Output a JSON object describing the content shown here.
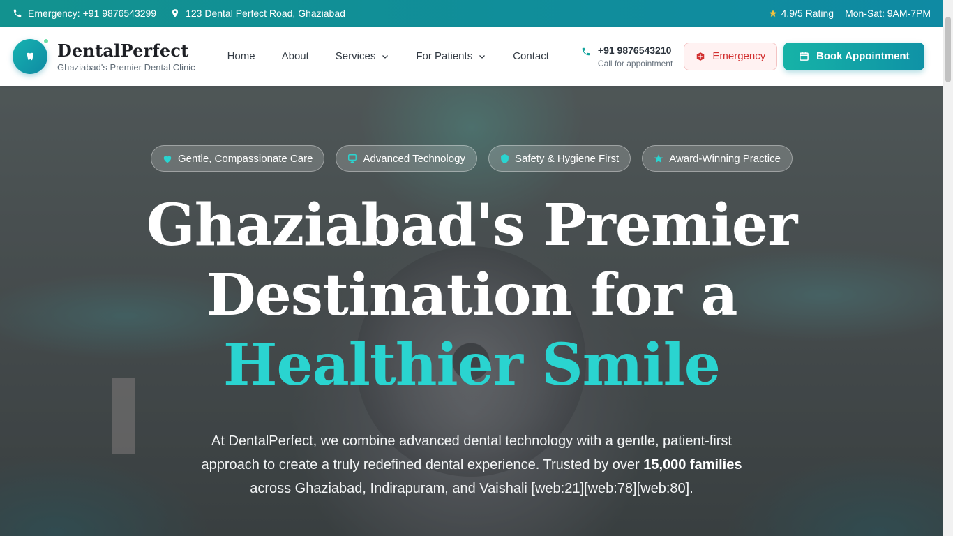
{
  "topbar": {
    "emergency": "Emergency: +91 9876543299",
    "address": "123 Dental Perfect Road, Ghaziabad",
    "rating": "4.9/5 Rating",
    "hours": "Mon-Sat: 9AM-7PM"
  },
  "header": {
    "brand_name": "DentalPerfect",
    "brand_tagline": "Ghaziabad's Premier Dental Clinic",
    "nav": [
      {
        "label": "Home",
        "icon": ""
      },
      {
        "label": "About",
        "icon": ""
      },
      {
        "label": "Services",
        "icon": "chevron-down-icon"
      },
      {
        "label": "For Patients",
        "icon": "chevron-down-icon"
      },
      {
        "label": "Contact",
        "icon": ""
      }
    ],
    "phone": "+91 9876543210",
    "phone_sub": "Call for appointment",
    "emergency_button": "Emergency",
    "book_button": "Book Appointment"
  },
  "hero": {
    "badges": [
      {
        "label": "Gentle, Compassionate Care",
        "icon": "heart-icon"
      },
      {
        "label": "Advanced Technology",
        "icon": "monitor-icon"
      },
      {
        "label": "Safety & Hygiene First",
        "icon": "shield-icon"
      },
      {
        "label": "Award-Winning Practice",
        "icon": "star-icon"
      }
    ],
    "headline_line1": "Ghaziabad's Premier",
    "headline_line2": "Destination for a",
    "headline_accent": "Healthier Smile",
    "desc_line1": "At DentalPerfect, we combine advanced dental technology with a gentle, patient-first",
    "desc_line2_pre": "approach to create a truly redefined dental experience. Trusted by over ",
    "desc_line2_bold": "15,000 families",
    "desc_line3": "across Ghaziabad, Indirapuram, and Vaishali [web:21][web:78][web:80]."
  },
  "colors": {
    "brand_teal": "#12928f",
    "accent_cyan": "#2ad4d0",
    "emergency_red": "#d23030"
  }
}
